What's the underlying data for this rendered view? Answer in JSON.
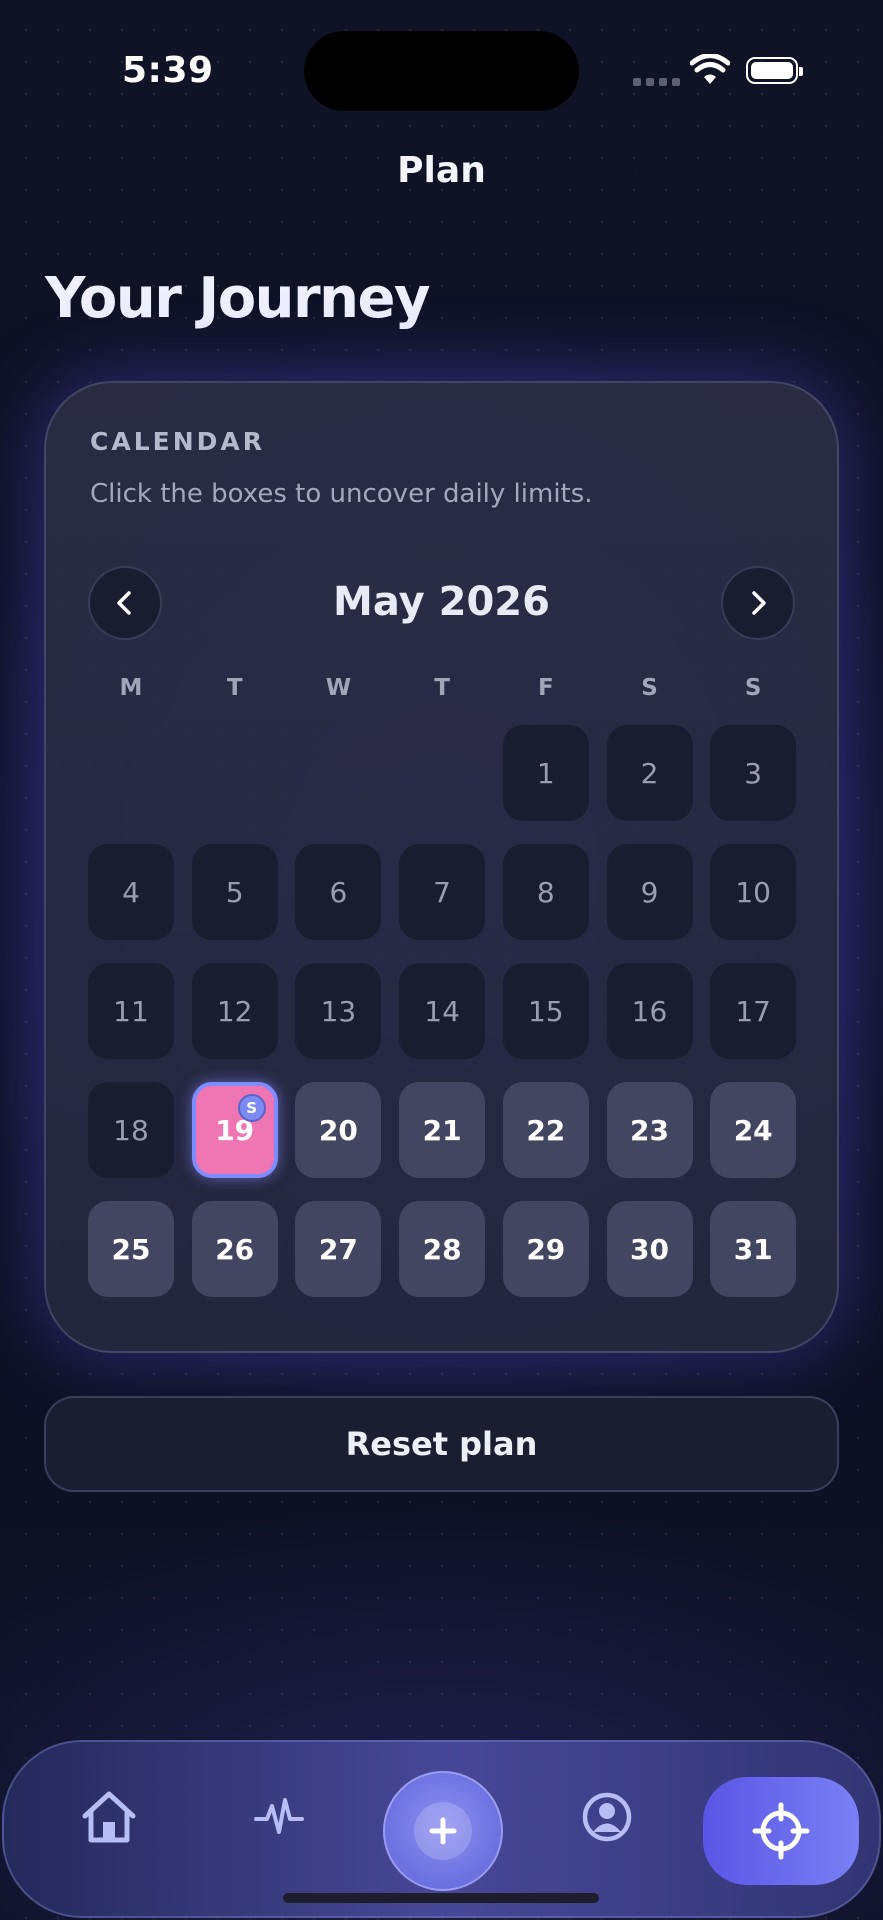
{
  "status_bar": {
    "time": "5:39"
  },
  "nav": {
    "title": "Plan"
  },
  "page": {
    "title": "Your Journey"
  },
  "calendar": {
    "label": "CALENDAR",
    "subtitle": "Click the boxes to uncover daily limits.",
    "month": "May 2026",
    "weekdays": [
      "M",
      "T",
      "W",
      "T",
      "F",
      "S",
      "S"
    ],
    "first_weekday_index": 4,
    "days_in_month": 31,
    "today": 19,
    "today_badge": "S"
  },
  "reset": {
    "label": "Reset plan"
  },
  "tabbar": {
    "tabs": [
      "home-icon",
      "activity-icon",
      "add-icon",
      "profile-icon",
      "target-icon"
    ],
    "active": "target-icon"
  },
  "colors": {
    "accent": "#6b6ff0",
    "today_fill": "#ef75b3",
    "past_day": "#1a1d30",
    "future_day": "#434660"
  }
}
